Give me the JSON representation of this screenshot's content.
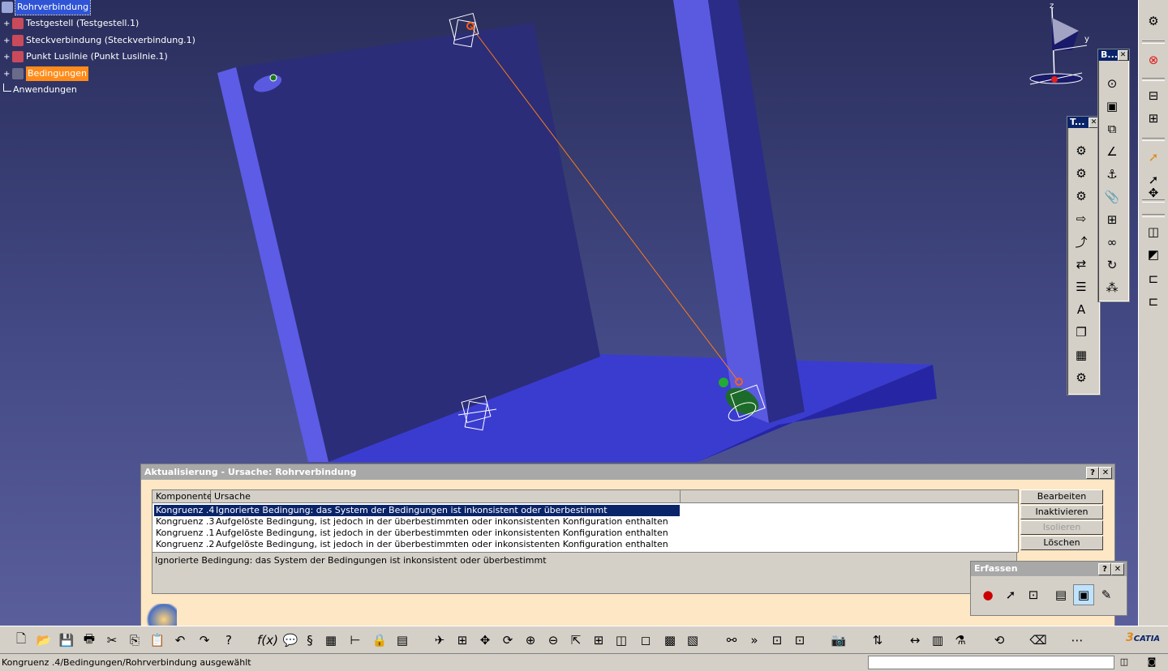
{
  "tree": {
    "root": "Rohrverbindung",
    "items": [
      {
        "label": "Testgestell (Testgestell.1)"
      },
      {
        "label": "Steckverbindung (Steckverbindung.1)"
      },
      {
        "label": "Punkt Lusilnie (Punkt Lusilnie.1)"
      },
      {
        "label": "Bedingungen"
      }
    ],
    "applications": "Anwendungen"
  },
  "compass": {
    "axis_z": "z",
    "axis_y": "y"
  },
  "toolbar_t": {
    "title": "T..."
  },
  "toolbar_b": {
    "title": "B..."
  },
  "dialog": {
    "title": "Aktualisierung - Ursache: Rohrverbindung",
    "columns": [
      "Komponente",
      "Ursache"
    ],
    "rows": [
      {
        "component": "Kongruenz .4",
        "cause": "Ignorierte Bedingung: das System der Bedingungen ist inkonsistent oder überbestimmt"
      },
      {
        "component": "Kongruenz .3",
        "cause": "Aufgelöste Bedingung, ist jedoch in der überbestimmten oder inkonsistenten Konfiguration enthalten"
      },
      {
        "component": "Kongruenz .1",
        "cause": "Aufgelöste Bedingung, ist jedoch in der überbestimmten oder inkonsistenten Konfiguration enthalten"
      },
      {
        "component": "Kongruenz .2",
        "cause": "Aufgelöste Bedingung, ist jedoch in der überbestimmten oder inkonsistenten Konfiguration enthalten"
      }
    ],
    "detail": "Ignorierte Bedingung: das System der Bedingungen ist inkonsistent oder überbestimmt",
    "buttons": {
      "edit": "Bearbeiten",
      "deactivate": "Inaktivieren",
      "isolate": "Isolieren",
      "delete": "Löschen"
    },
    "help": "?",
    "close": "✕"
  },
  "erfassen": {
    "title": "Erfassen"
  },
  "status": {
    "text": "Kongruenz .4/Bedingungen/Rohrverbindung ausgewählt"
  },
  "brand": {
    "logo_text": "CATIA"
  }
}
